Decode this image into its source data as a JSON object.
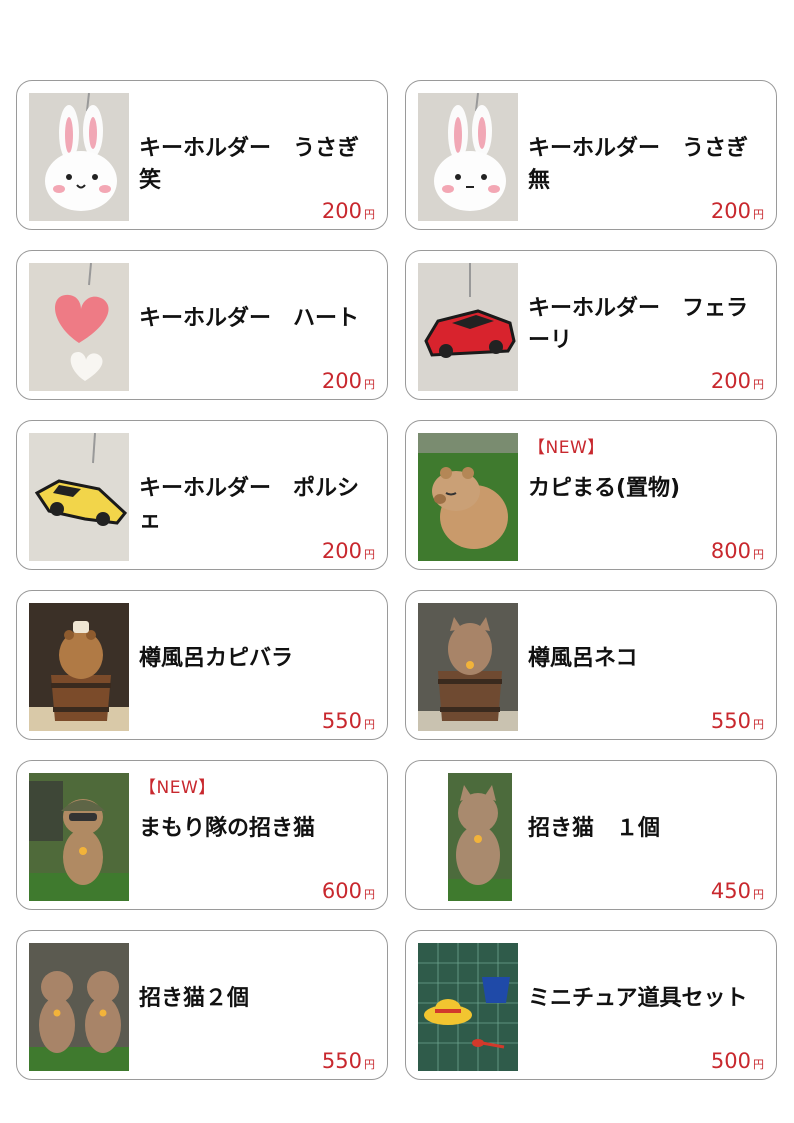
{
  "products": [
    {
      "name": "キーホルダー　うさぎ笑",
      "price": "200",
      "currency": "円",
      "badge": "",
      "image": "rabbit-smile-keychain"
    },
    {
      "name": "キーホルダー　うさぎ無",
      "price": "200",
      "currency": "円",
      "badge": "",
      "image": "rabbit-plain-keychain"
    },
    {
      "name": "キーホルダー　ハート",
      "price": "200",
      "currency": "円",
      "badge": "",
      "image": "heart-keychain"
    },
    {
      "name": "キーホルダー　フェラーリ",
      "price": "200",
      "currency": "円",
      "badge": "",
      "image": "red-car-keychain"
    },
    {
      "name": "キーホルダー　ポルシェ",
      "price": "200",
      "currency": "円",
      "badge": "",
      "image": "yellow-car-keychain"
    },
    {
      "name": "カピまる(置物)",
      "price": "800",
      "currency": "円",
      "badge": "【NEW】",
      "image": "capybara-figure"
    },
    {
      "name": "樽風呂カピバラ",
      "price": "550",
      "currency": "円",
      "badge": "",
      "image": "barrel-capybara"
    },
    {
      "name": "樽風呂ネコ",
      "price": "550",
      "currency": "円",
      "badge": "",
      "image": "barrel-cat"
    },
    {
      "name": "まもり隊の招き猫",
      "price": "600",
      "currency": "円",
      "badge": "【NEW】",
      "image": "helmet-lucky-cat"
    },
    {
      "name": "招き猫　１個",
      "price": "450",
      "currency": "円",
      "badge": "",
      "image": "lucky-cat-single"
    },
    {
      "name": "招き猫２個",
      "price": "550",
      "currency": "円",
      "badge": "",
      "image": "lucky-cat-pair"
    },
    {
      "name": "ミニチュア道具セット",
      "price": "500",
      "currency": "円",
      "badge": "",
      "image": "miniature-tools"
    }
  ]
}
